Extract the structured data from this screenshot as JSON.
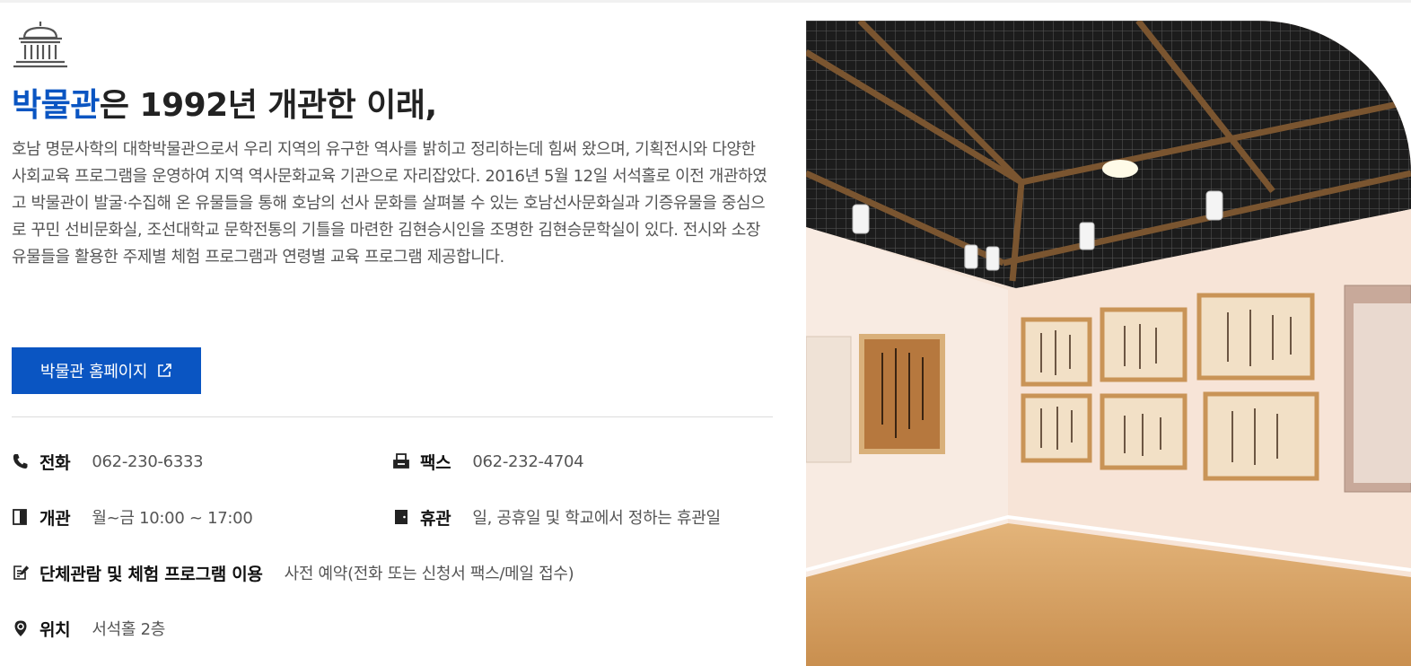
{
  "intro": {
    "icon": "museum-building-icon",
    "headline_highlight": "박물관",
    "headline_rest": "은 1992년 개관한 이래,",
    "description": "호남 명문사학의 대학박물관으로서 우리 지역의 유구한 역사를 밝히고 정리하는데 힘써 왔으며, 기획전시와 다양한 사회교육 프로그램을 운영하여 지역 역사문화교육 기관으로 자리잡았다. 2016년 5월 12일 서석홀로 이전 개관하였고 박물관이 발굴·수집해 온 유물들을 통해 호남의 선사 문화를 살펴볼 수 있는 호남선사문화실과 기증유물을 중심으로 꾸민 선비문화실, 조선대학교 문학전통의 기틀을 마련한 김현승시인을 조명한 김현승문학실이 있다. 전시와 소장 유물들을 활용한 주제별 체험 프로그램과 연령별 교육 프로그램 제공합니다.",
    "homepage_button": "박물관 홈페이지",
    "homepage_icon": "external-link-icon"
  },
  "info": {
    "phone": {
      "icon": "phone-icon",
      "label": "전화",
      "value": "062-230-6333"
    },
    "fax": {
      "icon": "fax-icon",
      "label": "팩스",
      "value": "062-232-4704"
    },
    "open": {
      "icon": "door-open-icon",
      "label": "개관",
      "value": "월~금 10:00 ~ 17:00"
    },
    "closed": {
      "icon": "door-closed-icon",
      "label": "휴관",
      "value": "일, 공휴일 및 학교에서 정하는 휴관일"
    },
    "group": {
      "icon": "edit-document-icon",
      "label": "단체관람 및 체험 프로그램 이용",
      "value": "사전 예약(전화 또는 신청서 팩스/메일 접수)"
    },
    "location": {
      "icon": "location-pin-icon",
      "label": "위치",
      "value": "서석홀 2층"
    }
  },
  "photo": {
    "subject": "gallery-interior-photo"
  },
  "colors": {
    "accent": "#0a55c2",
    "text_dark": "#222222",
    "text_muted": "#555555",
    "divider": "#dcdcdc"
  }
}
